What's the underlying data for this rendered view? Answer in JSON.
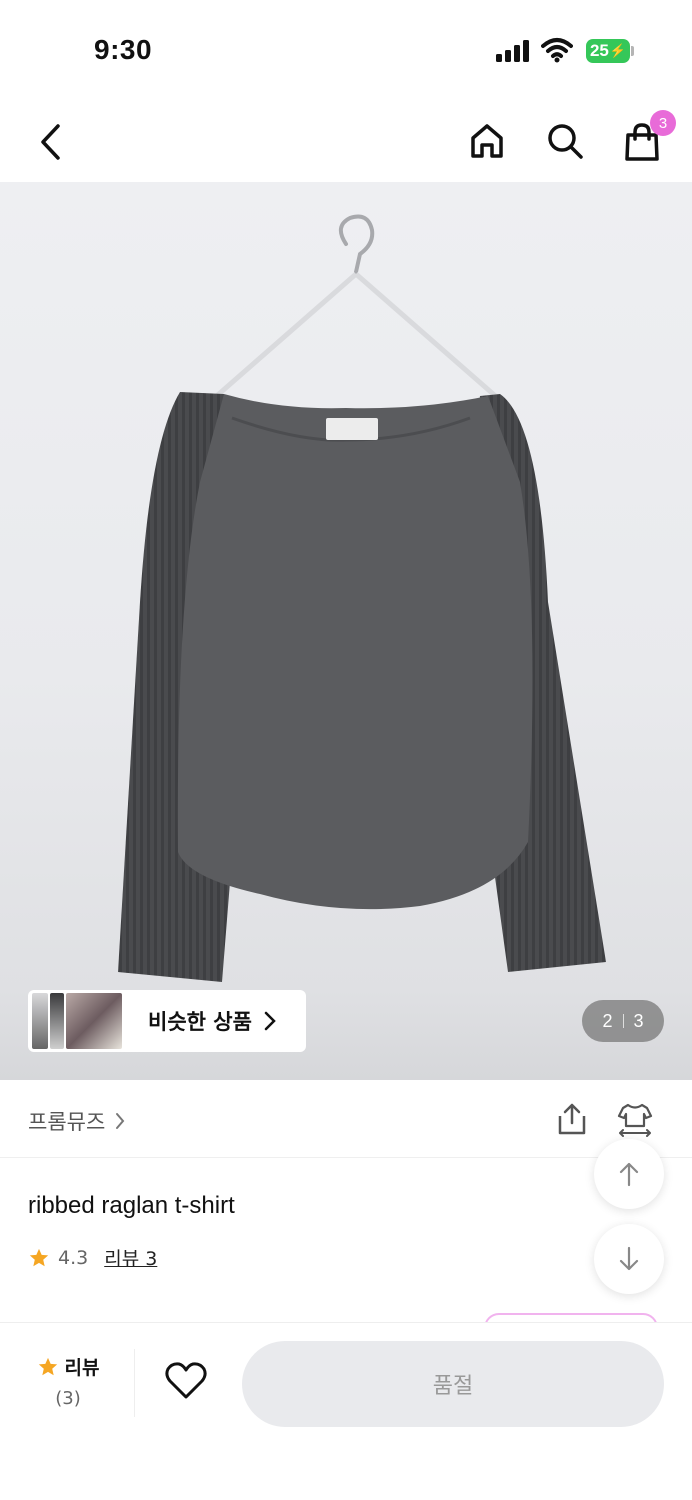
{
  "status": {
    "time": "9:30",
    "battery": "25"
  },
  "nav": {
    "back": "back-icon",
    "home": "home-icon",
    "search": "search-icon",
    "cart": "shopping-bag-icon",
    "cart_count": "3"
  },
  "hero": {
    "similar_label": "비슷한 상품",
    "page_current": "2",
    "page_total": "3"
  },
  "brand": {
    "name": "프롬뮤즈"
  },
  "product": {
    "title": "ribbed raglan t-shirt",
    "rating": "4.3",
    "review_link": "리뷰 3"
  },
  "bottom": {
    "review_label": "리뷰",
    "review_count": "(3)",
    "soldout_label": "품절"
  },
  "colors": {
    "accent": "#e86bd8",
    "star": "#f5a623",
    "battery": "#35c759"
  }
}
